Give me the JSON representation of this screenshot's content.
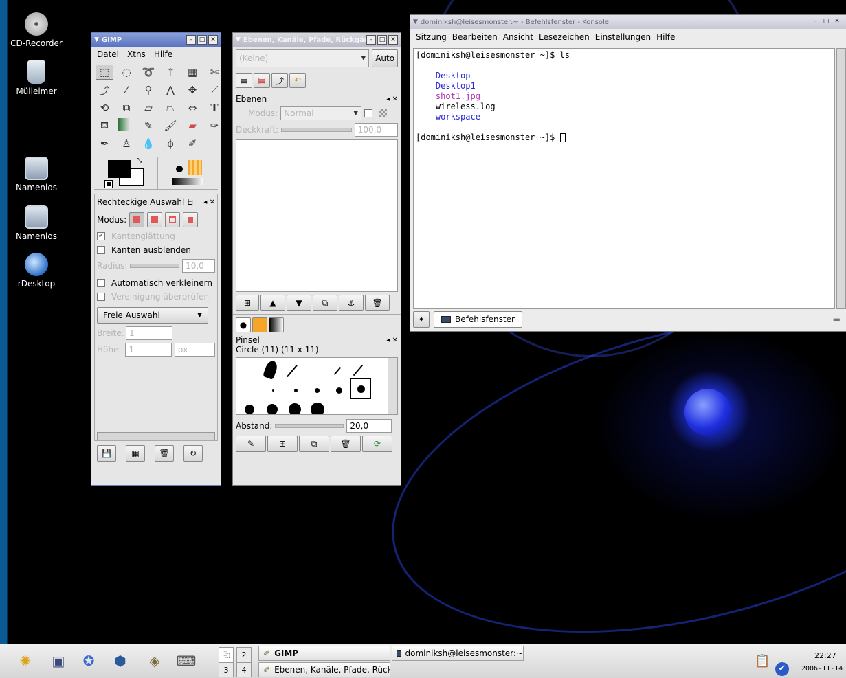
{
  "desktop": {
    "icons": [
      {
        "label": "CD-Recorder",
        "icon": "cd-icon"
      },
      {
        "label": "Mülleimer",
        "icon": "trash-icon"
      },
      {
        "label": "Namenlos",
        "icon": "monitor-icon"
      },
      {
        "label": "Namenlos",
        "icon": "monitor-icon"
      },
      {
        "label": "rDesktop",
        "icon": "remote-desktop-icon"
      }
    ]
  },
  "gimp_toolbox": {
    "title": "GIMP",
    "menu": [
      "Datei",
      "Xtns",
      "Hilfe"
    ],
    "tool_options": {
      "title": "Rechteckige Auswahl Eins",
      "mode_label": "Modus:",
      "antialias": "Kantenglättung",
      "feather": "Kanten ausblenden",
      "radius_label": "Radius:",
      "radius_value": "10,0",
      "auto_shrink": "Automatisch verkleinern",
      "merge": "Vereinigung überprüfen",
      "fixed_select": "Freie Auswahl",
      "width_label": "Breite:",
      "width_value": "1",
      "height_label": "Höhe:",
      "height_value": "1",
      "unit": "px"
    }
  },
  "layers_dialog": {
    "title": "Ebenen, Kanäle, Pfade, Rückgäng",
    "image_select": "(Keine)",
    "auto_button": "Auto",
    "layers_title": "Ebenen",
    "mode_label": "Modus:",
    "mode_value": "Normal",
    "opacity_label": "Deckkraft:",
    "opacity_value": "100,0",
    "brushes_title": "Pinsel",
    "brush_name": "Circle (11) (11 x 11)",
    "spacing_label": "Abstand:",
    "spacing_value": "20,0"
  },
  "konsole": {
    "title": "dominiksh@leisesmonster:~ - Befehlsfenster - Konsole",
    "menu": [
      "Sitzung",
      "Bearbeiten",
      "Ansicht",
      "Lesezeichen",
      "Einstellungen",
      "Hilfe"
    ],
    "line1": "[dominiksh@leisesmonster ~]$ ls",
    "ls_items": [
      {
        "name": "Desktop",
        "color": "#2b2bd6"
      },
      {
        "name": "Desktop1",
        "color": "#2b2bd6"
      },
      {
        "name": "shot1.jpg",
        "color": "#b02bb0"
      },
      {
        "name": "wireless.log",
        "color": "#000000"
      },
      {
        "name": "workspace",
        "color": "#2b2bd6"
      }
    ],
    "line3": "[dominiksh@leisesmonster ~]$ ",
    "tab_label": "Befehlsfenster"
  },
  "taskbar": {
    "pager": [
      "1",
      "2",
      "3",
      "4"
    ],
    "tasks": [
      {
        "label": "GIMP"
      },
      {
        "label": "dominiksh@leisesmonster:~"
      },
      {
        "label": "Ebenen, Kanäle, Pfade, Rückg"
      }
    ],
    "clock_time": "22:27",
    "clock_date": "2006-11-14"
  }
}
